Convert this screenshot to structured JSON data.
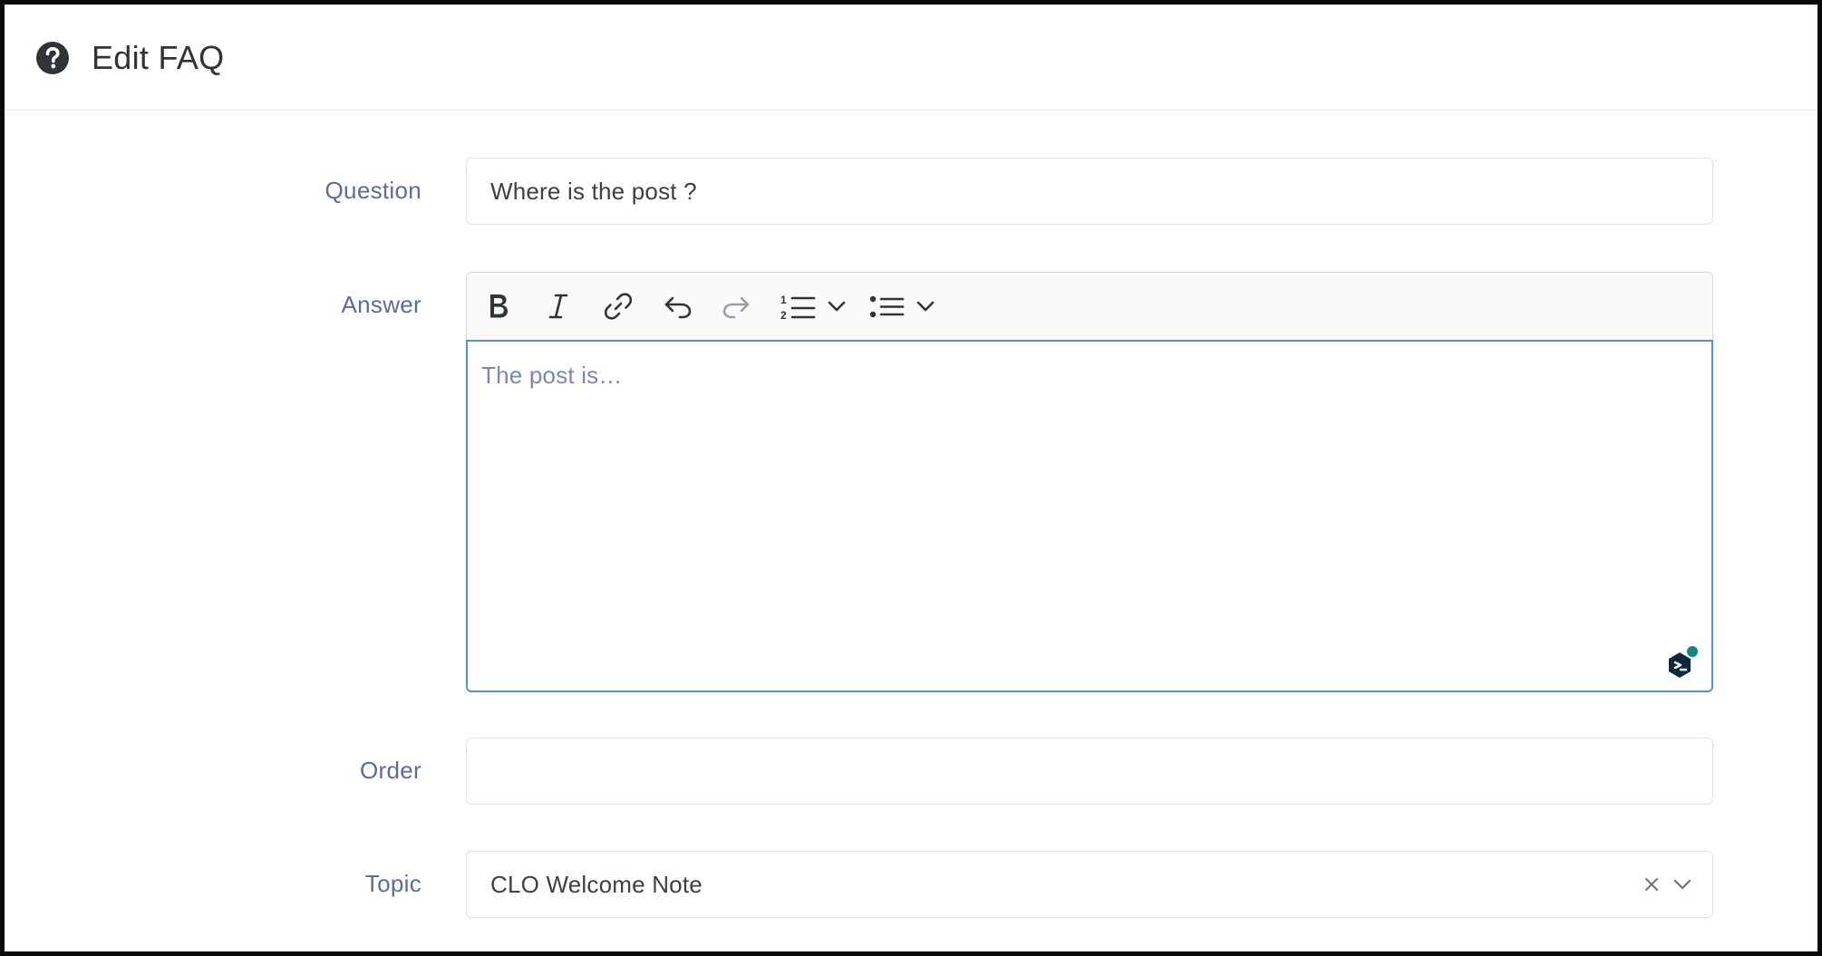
{
  "header": {
    "title": "Edit FAQ",
    "icon": "question-circle-icon"
  },
  "form": {
    "question": {
      "label": "Question",
      "value": "Where is the post ?"
    },
    "answer": {
      "label": "Answer",
      "value": "The post is…",
      "toolbar": [
        {
          "name": "bold-icon"
        },
        {
          "name": "italic-icon"
        },
        {
          "name": "link-icon"
        },
        {
          "name": "undo-icon"
        },
        {
          "name": "redo-icon"
        },
        {
          "name": "numbered-list-icon"
        },
        {
          "name": "bulleted-list-icon"
        }
      ]
    },
    "order": {
      "label": "Order",
      "value": ""
    },
    "topic": {
      "label": "Topic",
      "value": "CLO Welcome Note"
    }
  },
  "colors": {
    "label": "#5a6d9a",
    "focus_border": "#5a8fcf",
    "placeholder": "#7c86b4",
    "grammarly_dot": "#15867b"
  }
}
